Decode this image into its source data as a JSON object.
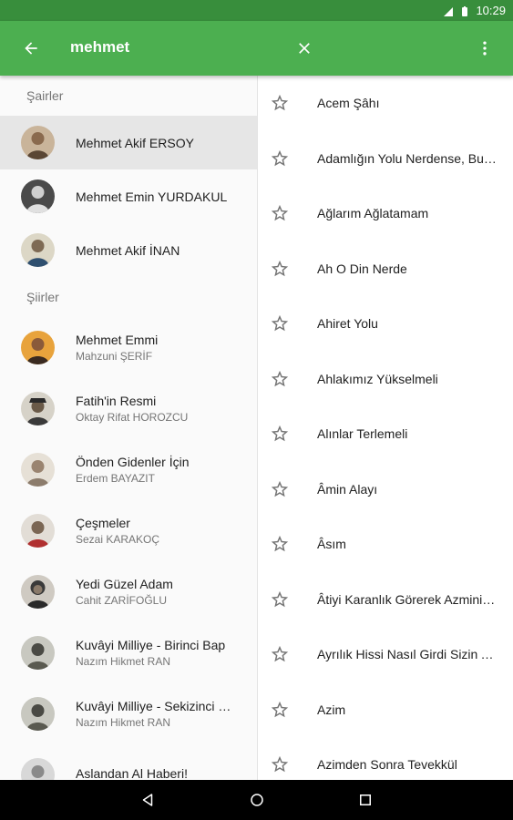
{
  "status": {
    "time": "10:29",
    "network": "4G"
  },
  "toolbar": {
    "query": "mehmet"
  },
  "sections": {
    "poets": "Şairler",
    "poems": "Şiirler"
  },
  "poets": [
    {
      "name": "Mehmet Akif ERSOY",
      "selected": true
    },
    {
      "name": "Mehmet Emin YURDAKUL",
      "selected": false
    },
    {
      "name": "Mehmet Akif İNAN",
      "selected": false
    }
  ],
  "poems": [
    {
      "title": "Mehmet Emmi",
      "author": "Mahzuni ŞERİF"
    },
    {
      "title": "Fatih'in Resmi",
      "author": "Oktay Rifat HOROZCU"
    },
    {
      "title": "Önden Gidenler İçin",
      "author": "Erdem BAYAZIT"
    },
    {
      "title": "Çeşmeler",
      "author": "Sezai KARAKOÇ"
    },
    {
      "title": "Yedi Güzel Adam",
      "author": "Cahit ZARİFOĞLU"
    },
    {
      "title": "Kuvâyi Milliye - Birinci Bap",
      "author": "Nazım Hikmet RAN"
    },
    {
      "title": "Kuvâyi Milliye - Sekizinci Bap",
      "author": "Nazım Hikmet RAN"
    },
    {
      "title": "Aslandan Al Haberi!",
      "author": ""
    }
  ],
  "works": [
    "Acem Şâhı",
    "Adamlığın Yolu Nerdense, Bu Yoldan Gidelim",
    "Ağlarım Ağlatamam",
    "Ah O Din Nerde",
    "Ahiret Yolu",
    "Ahlakımız Yükselmeli",
    "Alınlar Terlemeli",
    "Âmin Alayı",
    "Âsım",
    "Âtiyi Karanlık Görerek Azminiz Süstü",
    "Ayrılık Hissi Nasıl Girdi Sizin Aranıza",
    "Azim",
    "Azimden Sonra Tevekkül"
  ],
  "colors": {
    "primary": "#4caf50",
    "primary_dark": "#388e3c",
    "selected_row": "#e6e6e6"
  },
  "icons": {
    "back": "arrow-left-icon",
    "clear": "close-icon",
    "more": "more-vert-icon",
    "star": "star-outline-icon"
  }
}
